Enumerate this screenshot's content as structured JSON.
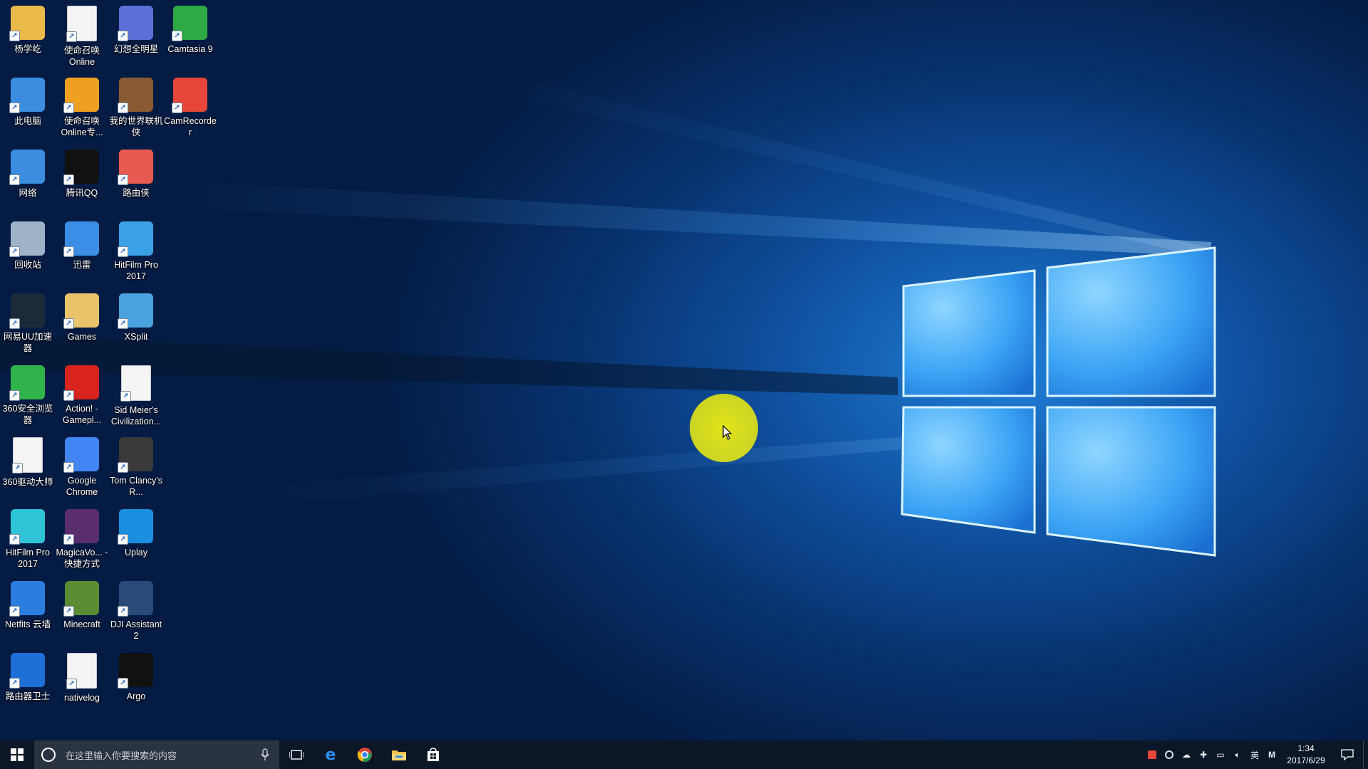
{
  "desktop": {
    "icons": [
      {
        "label": "杨学屹",
        "icon": "user-folder-icon",
        "color": "#e9b949"
      },
      {
        "label": "使命召唤Online",
        "icon": "document-icon",
        "color": "#f4f4f4"
      },
      {
        "label": "幻想全明星",
        "icon": "game-icon",
        "color": "#5b6fd8"
      },
      {
        "label": "Camtasia 9",
        "icon": "camtasia-icon",
        "color": "#2fa944"
      },
      {
        "label": "此电脑",
        "icon": "computer-icon",
        "color": "#3b8de0"
      },
      {
        "label": "使命召唤Online专...",
        "icon": "game-icon",
        "color": "#f0a020"
      },
      {
        "label": "我的世界联机侠",
        "icon": "house-icon",
        "color": "#8a5a32"
      },
      {
        "label": "CamRecorder",
        "icon": "camrecorder-icon",
        "color": "#e6473a"
      },
      {
        "label": "网络",
        "icon": "network-icon",
        "color": "#3b8de0"
      },
      {
        "label": "腾讯QQ",
        "icon": "qq-icon",
        "color": "#111111"
      },
      {
        "label": "路由侠",
        "icon": "router-icon",
        "color": "#e85a4f"
      },
      {
        "label": "回收站",
        "icon": "recycle-bin-icon",
        "color": "#9fb3c8"
      },
      {
        "label": "迅雷",
        "icon": "thunder-icon",
        "color": "#3a8ee6"
      },
      {
        "label": "HitFilm Pro 2017",
        "icon": "folder-icon",
        "color": "#3ba0e6"
      },
      {
        "label": "网易UU加速器",
        "icon": "uu-icon",
        "color": "#1d2a3a"
      },
      {
        "label": "Games",
        "icon": "folder-icon",
        "color": "#e9c46a"
      },
      {
        "label": "XSplit",
        "icon": "xsplit-icon",
        "color": "#4aa3df"
      },
      {
        "label": "360安全浏览器",
        "icon": "browser-icon",
        "color": "#2fb34a"
      },
      {
        "label": "Action! - Gamepl...",
        "icon": "record-icon",
        "color": "#d9231d"
      },
      {
        "label": "Sid Meier's Civilization...",
        "icon": "document-icon",
        "color": "#f4f4f4"
      },
      {
        "label": "360驱动大师",
        "icon": "document-icon",
        "color": "#f4f4f4"
      },
      {
        "label": "Google Chrome",
        "icon": "chrome-icon",
        "color": "#4285f4"
      },
      {
        "label": "Tom Clancy's R...",
        "icon": "game-icon",
        "color": "#3a3a3a"
      },
      {
        "label": "HitFilm Pro 2017",
        "icon": "hitfilm-icon",
        "color": "#2ec4d6"
      },
      {
        "label": "MagicaVo... - 快捷方式",
        "icon": "game-icon",
        "color": "#5a2d6e"
      },
      {
        "label": "Uplay",
        "icon": "uplay-icon",
        "color": "#1a8fe0"
      },
      {
        "label": "Netfits 云墙",
        "icon": "globe-icon",
        "color": "#2b7de0"
      },
      {
        "label": "Minecraft",
        "icon": "minecraft-icon",
        "color": "#5b8c32"
      },
      {
        "label": "DJI Assistant 2",
        "icon": "dji-icon",
        "color": "#2a4a7a"
      },
      {
        "label": "路由器卫士",
        "icon": "router-guard-icon",
        "color": "#1f6fd8"
      },
      {
        "label": "nativelog",
        "icon": "text-file-icon",
        "color": "#f4f4f4"
      },
      {
        "label": "Argo",
        "icon": "argo-icon",
        "color": "#111111"
      }
    ]
  },
  "taskbar": {
    "search_placeholder": "在这里输入你要搜索的内容",
    "pinned_apps": [
      "task-view-icon",
      "edge-icon",
      "chrome-icon",
      "file-explorer-icon",
      "store-icon"
    ],
    "tray": {
      "language": "英",
      "ime": "M",
      "time": "1:34",
      "date": "2017/6/29"
    }
  }
}
